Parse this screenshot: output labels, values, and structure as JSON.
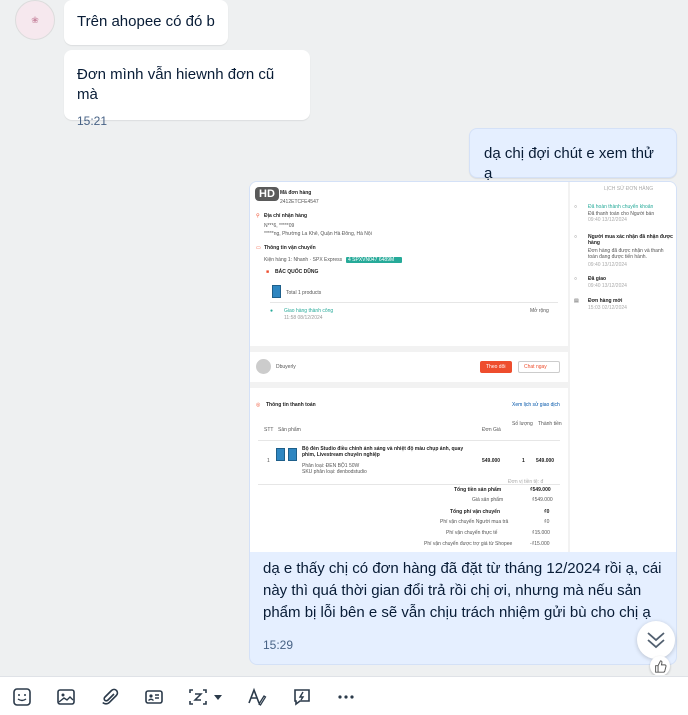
{
  "messages": [
    {
      "text": "Trên ahopee có đó b"
    },
    {
      "text": "Đơn mình vẫn hiewnh đơn cũ mà",
      "time": "15:21"
    },
    {
      "text": "dạ chị đợi chút e xem thử ạ"
    }
  ],
  "media_message": {
    "badge": "HD",
    "caption": "dạ e thấy chị có đơn hàng đã đặt từ tháng 12/2024 rồi ạ, cái này thì quá thời gian đổi trả rồi chị ơi, nhưng mà nếu sản phẩm bị lỗi bên e sẽ vẫn chịu trách nhiệm gửi bù cho chị ạ",
    "time": "15:29",
    "screenshot": {
      "order": {
        "title": "Mã đơn hàng",
        "order_id": "2412ETCFE4547",
        "address_title": "Địa chỉ nhận hàng",
        "address_name": "N***6, *****09",
        "address_line": "*****ng, Phường La Khê, Quận Hà Đông, Hà Nội",
        "shipping_title": "Thông tin vận chuyển",
        "shipping_line": "Kiện hàng 1:  Nhanh · SPX Express",
        "tracking": "4 SPXVN047 6489M",
        "shop": "BÁC QUỐC DŨNG",
        "total": "Total 1 products",
        "delivered": "Giao hàng thành công",
        "delivered_time": "11:58 08/12/2024",
        "expand": "Mở rộng"
      },
      "history": {
        "title": "LỊCH SỬ ĐƠN HÀNG",
        "events": [
          {
            "title": "Đã hoàn thành chuyển khoản",
            "detail": "Đã thanh toán cho Người bán",
            "time": "09:40 13/12/2024"
          },
          {
            "title": "Người mua xác nhận đã nhận được hàng",
            "detail": "Đơn hàng đã được nhận và thanh toán đang được tiến hành.",
            "time": "09:40 13/12/2024"
          },
          {
            "title": "Đã giao",
            "detail": "",
            "time": "09:40 13/12/2024"
          },
          {
            "title": "Đơn hàng mới",
            "detail": "",
            "time": "15:03 02/12/2024"
          }
        ]
      },
      "buyer": {
        "name": "Dbuyerly",
        "follow": "Theo dõi",
        "chat": "Chat ngay"
      },
      "payment": {
        "title": "Thông tin thanh toán",
        "link": "Xem lịch sử giao dịch",
        "headers": [
          "STT",
          "Sản phẩm",
          "Đơn Giá",
          "Số lượng",
          "Thành tiền"
        ],
        "row": {
          "no": "1",
          "name": "Bộ đèn Studio điều chỉnh ánh sáng và nhiệt độ màu chụp ảnh, quay phim, Livestream chuyên nghiệp",
          "sku": "Phân loại: ĐEN BỘ1 50W",
          "sku2": "SKU phân loại: đenbodstudio",
          "price": "549.000",
          "qty": "1",
          "amount": "549.000"
        },
        "currency_note": "Đơn vị tiền tệ: đ",
        "lines": [
          {
            "label": "Tổng tiền sản phẩm",
            "value": "₫549.000",
            "bold": true
          },
          {
            "label": "Giá sản phẩm",
            "value": "₫549.000",
            "bold": false
          },
          {
            "label": "Tổng phí vận chuyển",
            "value": "₫0",
            "bold": true
          },
          {
            "label": "Phí vận chuyển Người mua trả",
            "value": "₫0",
            "bold": false
          },
          {
            "label": "Phí vận chuyển thực tế",
            "value": "₫15.000",
            "bold": false
          },
          {
            "label": "Phí vận chuyển được trợ giá từ Shopee",
            "value": "-₫15.000",
            "bold": false
          }
        ]
      }
    }
  },
  "toolbar": {
    "icons": [
      "sticker-icon",
      "image-icon",
      "attachment-icon",
      "contact-card-icon",
      "capture-icon",
      "format-text-icon",
      "quick-message-icon",
      "more-icon"
    ]
  },
  "colors": {
    "bubble_me": "#e5efff",
    "bubble_other": "#ffffff",
    "accent": "#0068ff",
    "shopee": "#ee4d2d",
    "teal": "#26aa99"
  }
}
